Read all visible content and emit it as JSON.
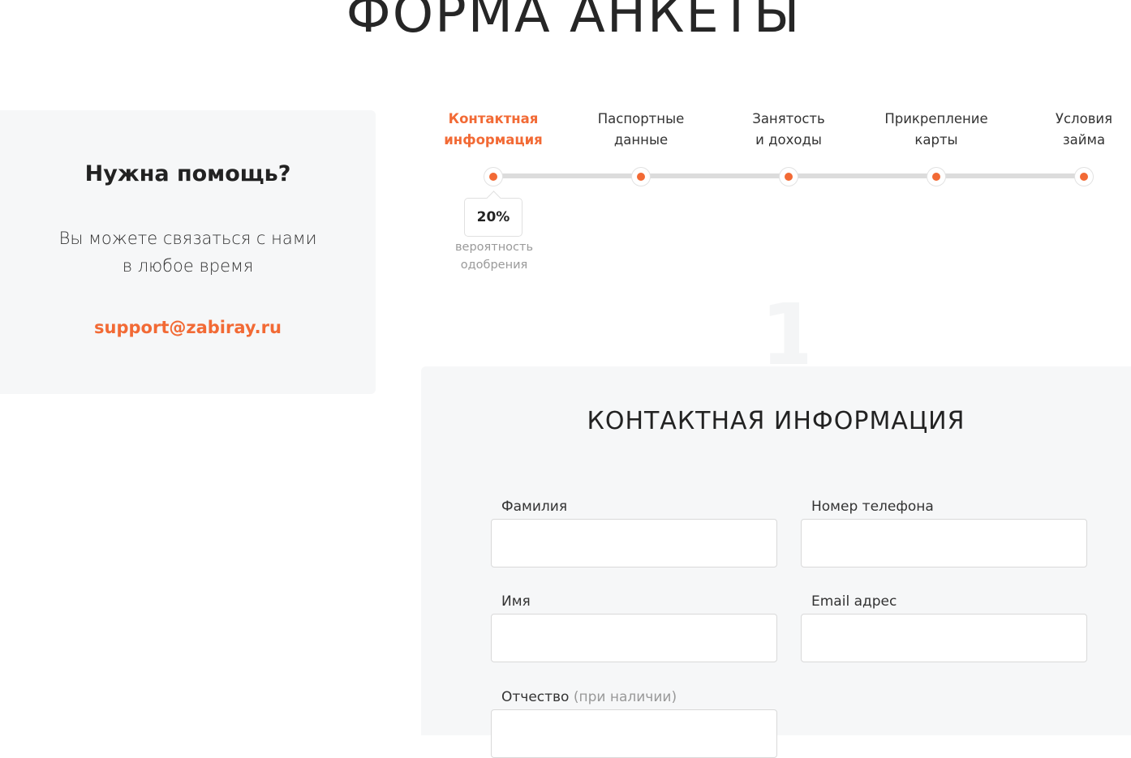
{
  "page": {
    "title": "ФОРМА АНКЕТЫ"
  },
  "help": {
    "title": "Нужна помощь?",
    "text_line1": "Вы можете связаться с нами",
    "text_line2": "в любое время",
    "email": "support@zabiray.ru"
  },
  "steps": [
    {
      "line1": "Контактная",
      "line2": "информация",
      "active": true
    },
    {
      "line1": "Паспортные",
      "line2": "данные",
      "active": false
    },
    {
      "line1": "Занятость",
      "line2": "и доходы",
      "active": false
    },
    {
      "line1": "Прикрепление",
      "line2": "карты",
      "active": false
    },
    {
      "line1": "Условия",
      "line2": "займа",
      "active": false
    }
  ],
  "probability": {
    "value": "20%",
    "caption_line1": "вероятность",
    "caption_line2": "одобрения"
  },
  "step_number": "1",
  "form": {
    "title": "КОНТАКТНАЯ ИНФОРМАЦИЯ",
    "fields": {
      "last_name": {
        "label": "Фамилия",
        "value": ""
      },
      "phone": {
        "label": "Номер телефона",
        "value": ""
      },
      "first_name": {
        "label": "Имя",
        "value": ""
      },
      "email": {
        "label": "Email адрес",
        "value": ""
      },
      "patronymic": {
        "label": "Отчество",
        "note": "(при наличии)",
        "value": ""
      }
    }
  },
  "colors": {
    "accent": "#f26a35",
    "card_bg": "#f6f7f8",
    "track": "#dcdcdc"
  }
}
